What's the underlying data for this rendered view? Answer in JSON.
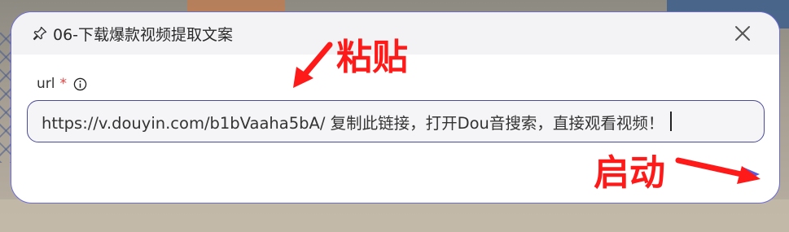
{
  "dialog": {
    "title": "06-下载爆款视频提取文案",
    "field_label": "url",
    "required_mark": "*",
    "url_value": "https://v.douyin.com/b1bVaaha5bA/ 复制此链接，打开Dou音搜索，直接观看视频！"
  },
  "annotations": {
    "paste": "粘贴",
    "start": "启动"
  },
  "colors": {
    "dialog_border": "#6b6bd6",
    "annotation": "#ff1a1a",
    "required": "#e04040",
    "submit": "#5a5ae0"
  },
  "icons": [
    "pin-icon",
    "close-icon",
    "info-icon",
    "send-icon"
  ]
}
